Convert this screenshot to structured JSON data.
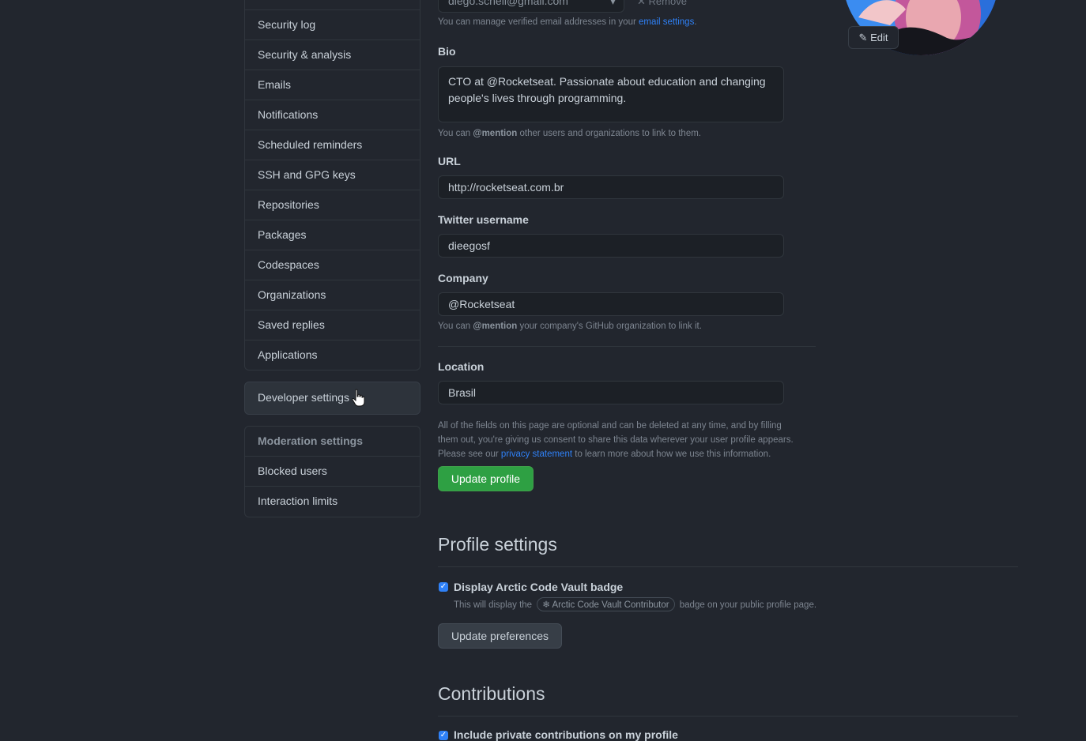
{
  "sidebar": {
    "items": [
      "Security log",
      "Security & analysis",
      "Emails",
      "Notifications",
      "Scheduled reminders",
      "SSH and GPG keys",
      "Repositories",
      "Packages",
      "Codespaces",
      "Organizations",
      "Saved replies",
      "Applications"
    ],
    "developer_settings": "Developer settings",
    "moderation_heading": "Moderation settings",
    "moderation_items": [
      "Blocked users",
      "Interaction limits"
    ]
  },
  "profile": {
    "email_value": "diego.schell@gmail.com",
    "remove_label": "Remove",
    "email_note": "You can manage verified email addresses in your",
    "email_note_link": "email settings",
    "email_note_end": ".",
    "bio_label": "Bio",
    "bio_value": "CTO at @Rocketseat. Passionate about education and changing people's lives through programming.",
    "bio_note_start": "You can",
    "bio_note_mention": "@mention",
    "bio_note_end": "other users and organizations to link to them.",
    "url_label": "URL",
    "url_value": "http://rocketseat.com.br",
    "twitter_label": "Twitter username",
    "twitter_value": "dieegosf",
    "company_label": "Company",
    "company_value": "@Rocketseat",
    "company_note_start": "You can",
    "company_note_mention": "@mention",
    "company_note_end": "your company's GitHub organization to link it.",
    "location_label": "Location",
    "location_value": "Brasil",
    "privacy_note_1": "All of the fields on this page are optional and can be deleted at any time, and by filling",
    "privacy_note_2": "them out, you're giving us consent to share this data wherever your user profile appears.",
    "privacy_note_3_start": "Please see our",
    "privacy_note_3_link": "privacy statement",
    "privacy_note_3_end": "to learn more about how we use this information.",
    "update_button": "Update profile",
    "avatar_edit": "Edit"
  },
  "profile_settings": {
    "title": "Profile settings",
    "checkbox_label": "Display Arctic Code Vault badge",
    "checkbox_checked": true,
    "note_start": "This will display the",
    "badge": "Arctic Code Vault Contributor",
    "note_end": "badge on your public profile page.",
    "update_button": "Update preferences"
  },
  "contributions": {
    "title": "Contributions",
    "checkbox_label": "Include private contributions on my profile",
    "checkbox_checked": true
  },
  "colors": {
    "background": "#22262e",
    "accent_green": "#2ea043",
    "link_blue": "#2f81f7"
  }
}
